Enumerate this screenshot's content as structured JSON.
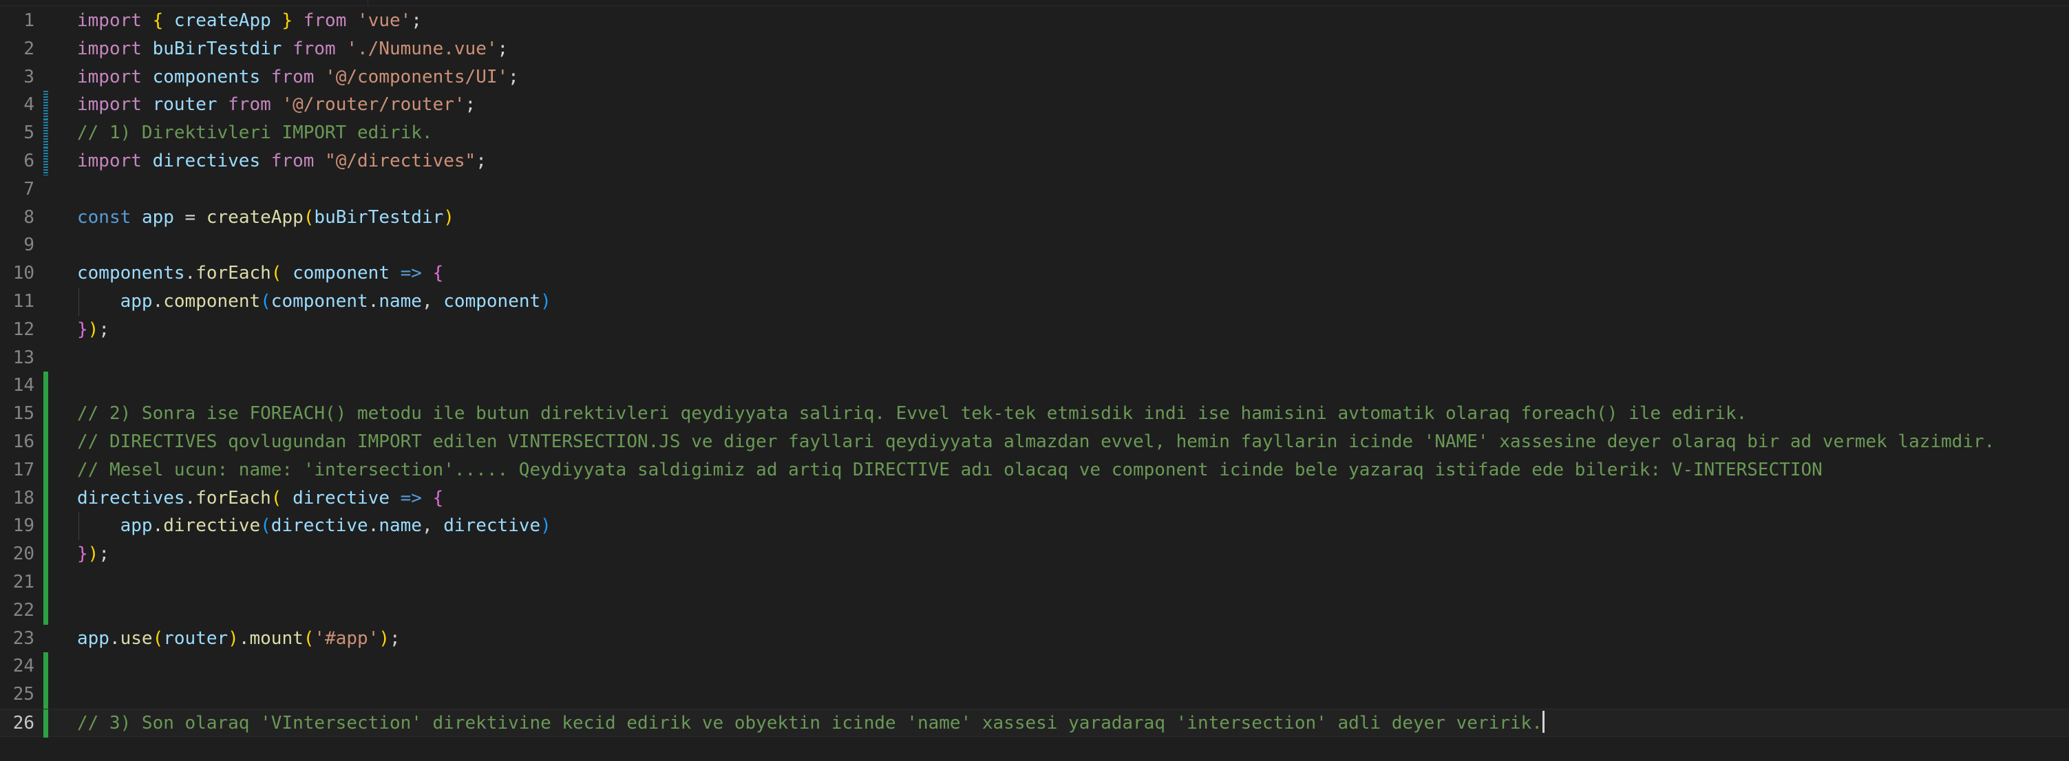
{
  "editor": {
    "active_line": 26,
    "lines": [
      {
        "number": "1",
        "change": "none",
        "indent": false,
        "tokens": [
          {
            "t": "import",
            "c": "key"
          },
          {
            "t": " ",
            "c": "punc"
          },
          {
            "t": "{",
            "c": "b1"
          },
          {
            "t": " createApp ",
            "c": "var"
          },
          {
            "t": "}",
            "c": "b1"
          },
          {
            "t": " ",
            "c": "punc"
          },
          {
            "t": "from",
            "c": "key"
          },
          {
            "t": " ",
            "c": "punc"
          },
          {
            "t": "'vue'",
            "c": "str"
          },
          {
            "t": ";",
            "c": "punc"
          }
        ]
      },
      {
        "number": "2",
        "change": "none",
        "indent": false,
        "tokens": [
          {
            "t": "import",
            "c": "key"
          },
          {
            "t": " ",
            "c": "punc"
          },
          {
            "t": "buBirTestdir",
            "c": "var"
          },
          {
            "t": " ",
            "c": "punc"
          },
          {
            "t": "from",
            "c": "key"
          },
          {
            "t": " ",
            "c": "punc"
          },
          {
            "t": "'./Numune.vue'",
            "c": "str"
          },
          {
            "t": ";",
            "c": "punc"
          }
        ]
      },
      {
        "number": "3",
        "change": "none",
        "indent": false,
        "tokens": [
          {
            "t": "import",
            "c": "key"
          },
          {
            "t": " ",
            "c": "punc"
          },
          {
            "t": "components",
            "c": "var"
          },
          {
            "t": " ",
            "c": "punc"
          },
          {
            "t": "from",
            "c": "key"
          },
          {
            "t": " ",
            "c": "punc"
          },
          {
            "t": "'@/components/UI'",
            "c": "str"
          },
          {
            "t": ";",
            "c": "punc"
          }
        ]
      },
      {
        "number": "4",
        "change": "modified",
        "indent": false,
        "tokens": [
          {
            "t": "import",
            "c": "key"
          },
          {
            "t": " ",
            "c": "punc"
          },
          {
            "t": "router",
            "c": "var"
          },
          {
            "t": " ",
            "c": "punc"
          },
          {
            "t": "from",
            "c": "key"
          },
          {
            "t": " ",
            "c": "punc"
          },
          {
            "t": "'@/router/router'",
            "c": "str"
          },
          {
            "t": ";",
            "c": "punc"
          }
        ]
      },
      {
        "number": "5",
        "change": "modified",
        "indent": false,
        "tokens": [
          {
            "t": "// 1) Direktivleri IMPORT edirik.",
            "c": "cmt"
          }
        ]
      },
      {
        "number": "6",
        "change": "modified",
        "indent": false,
        "tokens": [
          {
            "t": "import",
            "c": "key"
          },
          {
            "t": " ",
            "c": "punc"
          },
          {
            "t": "directives",
            "c": "var"
          },
          {
            "t": " ",
            "c": "punc"
          },
          {
            "t": "from",
            "c": "key"
          },
          {
            "t": " ",
            "c": "punc"
          },
          {
            "t": "\"@/directives\"",
            "c": "str"
          },
          {
            "t": ";",
            "c": "punc"
          }
        ]
      },
      {
        "number": "7",
        "change": "none",
        "indent": false,
        "tokens": []
      },
      {
        "number": "8",
        "change": "none",
        "indent": false,
        "tokens": [
          {
            "t": "const",
            "c": "kw"
          },
          {
            "t": " ",
            "c": "punc"
          },
          {
            "t": "app",
            "c": "var"
          },
          {
            "t": " = ",
            "c": "punc"
          },
          {
            "t": "createApp",
            "c": "fn"
          },
          {
            "t": "(",
            "c": "b1"
          },
          {
            "t": "buBirTestdir",
            "c": "var"
          },
          {
            "t": ")",
            "c": "b1"
          }
        ]
      },
      {
        "number": "9",
        "change": "none",
        "indent": false,
        "tokens": []
      },
      {
        "number": "10",
        "change": "none",
        "indent": false,
        "tokens": [
          {
            "t": "components",
            "c": "var"
          },
          {
            "t": ".",
            "c": "punc"
          },
          {
            "t": "forEach",
            "c": "fn"
          },
          {
            "t": "(",
            "c": "b1"
          },
          {
            "t": " ",
            "c": "punc"
          },
          {
            "t": "component",
            "c": "var"
          },
          {
            "t": " ",
            "c": "punc"
          },
          {
            "t": "=>",
            "c": "kw"
          },
          {
            "t": " ",
            "c": "punc"
          },
          {
            "t": "{",
            "c": "b2"
          }
        ]
      },
      {
        "number": "11",
        "change": "none",
        "indent": true,
        "tokens": [
          {
            "t": "    ",
            "c": "punc"
          },
          {
            "t": "app",
            "c": "var"
          },
          {
            "t": ".",
            "c": "punc"
          },
          {
            "t": "component",
            "c": "fn"
          },
          {
            "t": "(",
            "c": "b3"
          },
          {
            "t": "component",
            "c": "var"
          },
          {
            "t": ".",
            "c": "punc"
          },
          {
            "t": "name",
            "c": "var"
          },
          {
            "t": ", ",
            "c": "punc"
          },
          {
            "t": "component",
            "c": "var"
          },
          {
            "t": ")",
            "c": "b3"
          }
        ]
      },
      {
        "number": "12",
        "change": "none",
        "indent": false,
        "tokens": [
          {
            "t": "}",
            "c": "b2"
          },
          {
            "t": ")",
            "c": "b1"
          },
          {
            "t": ";",
            "c": "punc"
          }
        ]
      },
      {
        "number": "13",
        "change": "none",
        "indent": false,
        "tokens": []
      },
      {
        "number": "14",
        "change": "added",
        "indent": false,
        "tokens": []
      },
      {
        "number": "15",
        "change": "added",
        "indent": false,
        "tokens": [
          {
            "t": "// 2) Sonra ise FOREACH() metodu ile butun direktivleri qeydiyyata saliriq. Evvel tek-tek etmisdik indi ise hamisini avtomatik olaraq foreach() ile edirik.",
            "c": "cmt"
          }
        ]
      },
      {
        "number": "16",
        "change": "added",
        "indent": false,
        "tokens": [
          {
            "t": "// DIRECTIVES qovlugundan IMPORT edilen VINTERSECTION.JS ve diger fayllari qeydiyyata almazdan evvel, hemin fayllarin icinde 'NAME' xassesine deyer olaraq bir ad vermek lazimdir.",
            "c": "cmt"
          }
        ]
      },
      {
        "number": "17",
        "change": "added",
        "indent": false,
        "tokens": [
          {
            "t": "// Mesel ucun: name: 'intersection'..... Qeydiyyata saldigimiz ad artiq DIRECTIVE adı olacaq ve component icinde bele yazaraq istifade ede bilerik: V-INTERSECTION",
            "c": "cmt"
          }
        ]
      },
      {
        "number": "18",
        "change": "added",
        "indent": false,
        "tokens": [
          {
            "t": "directives",
            "c": "var"
          },
          {
            "t": ".",
            "c": "punc"
          },
          {
            "t": "forEach",
            "c": "fn"
          },
          {
            "t": "(",
            "c": "b1"
          },
          {
            "t": " ",
            "c": "punc"
          },
          {
            "t": "directive",
            "c": "var"
          },
          {
            "t": " ",
            "c": "punc"
          },
          {
            "t": "=>",
            "c": "kw"
          },
          {
            "t": " ",
            "c": "punc"
          },
          {
            "t": "{",
            "c": "b2"
          }
        ]
      },
      {
        "number": "19",
        "change": "added",
        "indent": true,
        "tokens": [
          {
            "t": "    ",
            "c": "punc"
          },
          {
            "t": "app",
            "c": "var"
          },
          {
            "t": ".",
            "c": "punc"
          },
          {
            "t": "directive",
            "c": "fn"
          },
          {
            "t": "(",
            "c": "b3"
          },
          {
            "t": "directive",
            "c": "var"
          },
          {
            "t": ".",
            "c": "punc"
          },
          {
            "t": "name",
            "c": "var"
          },
          {
            "t": ", ",
            "c": "punc"
          },
          {
            "t": "directive",
            "c": "var"
          },
          {
            "t": ")",
            "c": "b3"
          }
        ]
      },
      {
        "number": "20",
        "change": "added",
        "indent": false,
        "tokens": [
          {
            "t": "}",
            "c": "b2"
          },
          {
            "t": ")",
            "c": "b1"
          },
          {
            "t": ";",
            "c": "punc"
          }
        ]
      },
      {
        "number": "21",
        "change": "added",
        "indent": false,
        "tokens": []
      },
      {
        "number": "22",
        "change": "added",
        "indent": false,
        "tokens": []
      },
      {
        "number": "23",
        "change": "none",
        "indent": false,
        "tokens": [
          {
            "t": "app",
            "c": "var"
          },
          {
            "t": ".",
            "c": "punc"
          },
          {
            "t": "use",
            "c": "fn"
          },
          {
            "t": "(",
            "c": "b1"
          },
          {
            "t": "router",
            "c": "var"
          },
          {
            "t": ")",
            "c": "b1"
          },
          {
            "t": ".",
            "c": "punc"
          },
          {
            "t": "mount",
            "c": "fn"
          },
          {
            "t": "(",
            "c": "b1"
          },
          {
            "t": "'#app'",
            "c": "str"
          },
          {
            "t": ")",
            "c": "b1"
          },
          {
            "t": ";",
            "c": "punc"
          }
        ]
      },
      {
        "number": "24",
        "change": "added",
        "indent": false,
        "tokens": []
      },
      {
        "number": "25",
        "change": "added",
        "indent": false,
        "tokens": []
      },
      {
        "number": "26",
        "change": "added",
        "indent": false,
        "tokens": [
          {
            "t": "// 3) Son olaraq 'VIntersection' direktivine kecid edirik ve obyektin icinde 'name' xassesi yaradaraq 'intersection' adli deyer veririk.",
            "c": "cmt"
          }
        ]
      }
    ]
  }
}
